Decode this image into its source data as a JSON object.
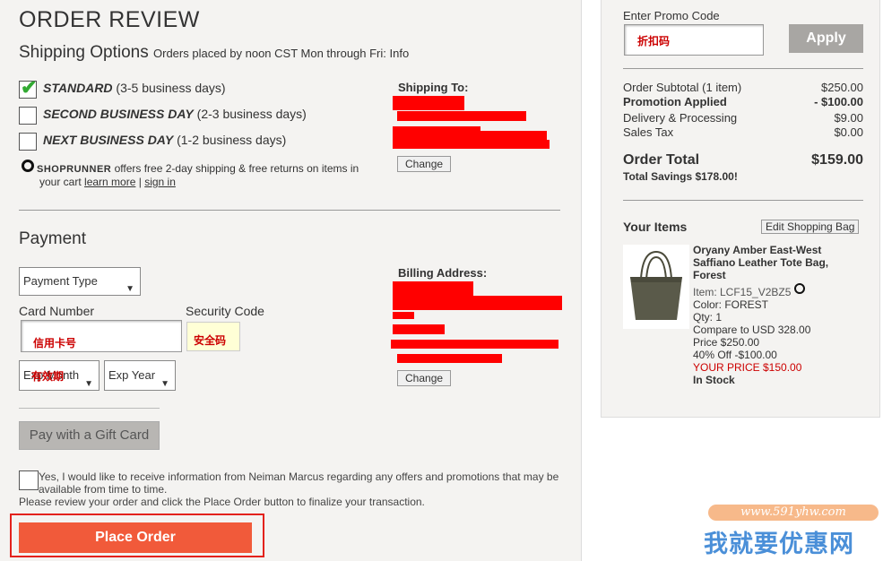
{
  "title": "ORDER REVIEW",
  "shipping": {
    "heading": "Shipping Options",
    "note": "Orders placed by noon CST Mon through Fri: Info",
    "options": [
      {
        "name": "STANDARD",
        "days": " (3-5 business days)",
        "checked": true
      },
      {
        "name": "SECOND BUSINESS DAY",
        "days": " (2-3 business days)",
        "checked": false
      },
      {
        "name": "NEXT BUSINESS DAY",
        "days": " (1-2 business days)",
        "checked": false
      }
    ],
    "shoprunner_logo": "SHOPRUNNER",
    "shoprunner_text": "offers free 2-day shipping & free returns on items in",
    "shoprunner_text2": "your cart",
    "learn_more": "learn more",
    "sep": "|",
    "sign_in": "sign in",
    "ship_to_label": "Shipping To:",
    "change_label": "Change"
  },
  "payment": {
    "heading": "Payment",
    "payment_type": "Payment Type",
    "card_number_label": "Card Number",
    "card_number_value": "信用卡号",
    "security_label": "Security Code",
    "security_value": "安全码",
    "exp_month": "Exp Month",
    "exp_overlay": "有效期",
    "exp_year": "Exp Year",
    "billing_label": "Billing Address:",
    "change_label": "Change",
    "gift_card_label": "Pay with a Gift Card"
  },
  "consent_text": "Yes, I would like to receive information from Neiman Marcus regarding any offers and promotions that may be available from time to time.",
  "review_text": "Please review your order and click the Place Order button to finalize your transaction.",
  "place_order_label": "Place Order",
  "summary": {
    "promo_label": "Enter Promo Code",
    "promo_value": "折扣码",
    "apply_label": "Apply",
    "rows": [
      {
        "label": "Order Subtotal (1 item)",
        "value": "$250.00",
        "bold": false
      },
      {
        "label": "Promotion Applied",
        "value": "- $100.00",
        "bold": true
      },
      {
        "label": "Delivery & Processing",
        "value": "$9.00",
        "bold": false
      },
      {
        "label": "Sales Tax",
        "value": "$0.00",
        "bold": false
      }
    ],
    "total_label": "Order Total",
    "total_value": "$159.00",
    "savings": "Total Savings $178.00!",
    "your_items": "Your Items",
    "edit_bag": "Edit Shopping Bag",
    "item": {
      "name": "Oryany Amber East-West Saffiano Leather Tote Bag, Forest",
      "item_no": "Item: LCF15_V2BZ5",
      "color": "Color: FOREST",
      "qty": "Qty: 1",
      "compare": "Compare to USD 328.00",
      "price": "Price $250.00",
      "off": "40% Off -$100.00",
      "your_price": "YOUR PRICE $150.00",
      "stock": "In Stock"
    }
  },
  "watermark": {
    "url": "www.591yhw.com",
    "text": "我就要优惠网"
  },
  "colors": {
    "accent": "#f15a3a",
    "redact": "#ff0000",
    "price_red": "#cc0000"
  }
}
